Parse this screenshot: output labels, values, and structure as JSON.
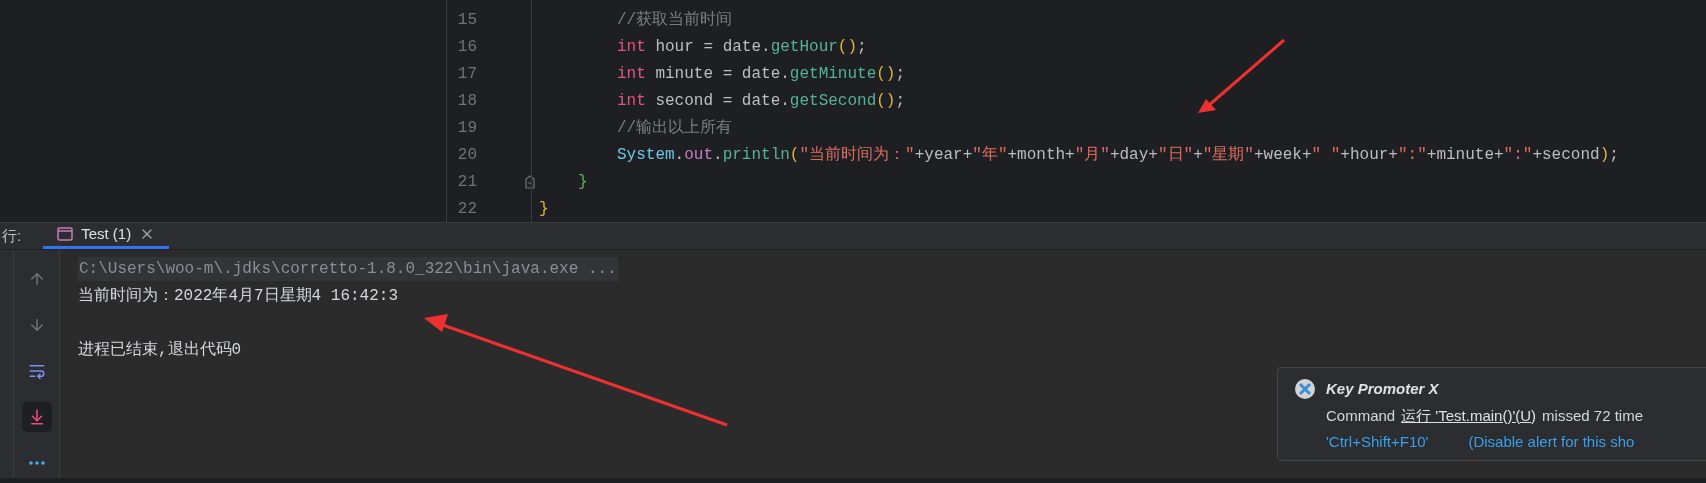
{
  "editor": {
    "lines": [
      {
        "number": "15",
        "kind": "body",
        "tokens": [
          {
            "kind": "comment",
            "text": "//获取当前时间"
          }
        ]
      },
      {
        "number": "16",
        "kind": "body",
        "tokens": [
          {
            "kind": "keyword",
            "text": "int"
          },
          {
            "kind": "plain",
            "text": " hour = date."
          },
          {
            "kind": "method",
            "text": "getHour"
          },
          {
            "kind": "paren",
            "text": "()"
          },
          {
            "kind": "plain",
            "text": ";"
          }
        ]
      },
      {
        "number": "17",
        "kind": "body",
        "tokens": [
          {
            "kind": "keyword",
            "text": "int"
          },
          {
            "kind": "plain",
            "text": " minute = date."
          },
          {
            "kind": "method",
            "text": "getMinute"
          },
          {
            "kind": "paren",
            "text": "()"
          },
          {
            "kind": "plain",
            "text": ";"
          }
        ]
      },
      {
        "number": "18",
        "kind": "body",
        "tokens": [
          {
            "kind": "keyword",
            "text": "int"
          },
          {
            "kind": "plain",
            "text": " second = date."
          },
          {
            "kind": "method",
            "text": "getSecond"
          },
          {
            "kind": "paren",
            "text": "()"
          },
          {
            "kind": "plain",
            "text": ";"
          }
        ]
      },
      {
        "number": "19",
        "kind": "body",
        "tokens": [
          {
            "kind": "comment",
            "text": "//输出以上所有"
          }
        ]
      },
      {
        "number": "20",
        "kind": "body",
        "tokens": [
          {
            "kind": "class",
            "text": "System"
          },
          {
            "kind": "plain",
            "text": "."
          },
          {
            "kind": "field",
            "text": "out"
          },
          {
            "kind": "plain",
            "text": "."
          },
          {
            "kind": "method",
            "text": "println"
          },
          {
            "kind": "paren",
            "text": "("
          },
          {
            "kind": "string",
            "text": "\"当前时间为：\""
          },
          {
            "kind": "plain",
            "text": "+year+"
          },
          {
            "kind": "string",
            "text": "\"年\""
          },
          {
            "kind": "plain",
            "text": "+month+"
          },
          {
            "kind": "string",
            "text": "\"月\""
          },
          {
            "kind": "plain",
            "text": "+day+"
          },
          {
            "kind": "string",
            "text": "\"日\""
          },
          {
            "kind": "plain",
            "text": "+"
          },
          {
            "kind": "string",
            "text": "\"星期\""
          },
          {
            "kind": "plain",
            "text": "+week+"
          },
          {
            "kind": "string",
            "text": "\" \""
          },
          {
            "kind": "plain",
            "text": "+hour+"
          },
          {
            "kind": "string",
            "text": "\":\""
          },
          {
            "kind": "plain",
            "text": "+minute+"
          },
          {
            "kind": "string",
            "text": "\":\""
          },
          {
            "kind": "plain",
            "text": "+second"
          },
          {
            "kind": "paren",
            "text": ")"
          },
          {
            "kind": "plain",
            "text": ";"
          }
        ]
      },
      {
        "number": "21",
        "kind": "method-end",
        "fold": true,
        "tokens": [
          {
            "kind": "brace",
            "text": "}"
          }
        ]
      },
      {
        "number": "22",
        "kind": "class-end",
        "tokens": [
          {
            "kind": "paren",
            "text": "}"
          }
        ]
      }
    ]
  },
  "run_panel": {
    "title": "行:",
    "tabs": [
      {
        "label": "Test (1)",
        "selected": true
      }
    ],
    "toolbar": [
      {
        "kind": "up",
        "selected": false
      },
      {
        "kind": "down",
        "selected": false
      },
      {
        "kind": "wrap",
        "selected": false
      },
      {
        "kind": "scroll-end",
        "selected": true
      },
      {
        "kind": "more",
        "selected": false
      }
    ],
    "console": [
      {
        "kind": "command",
        "text": "C:\\Users\\woo-m\\.jdks\\corretto-1.8.0_322\\bin\\java.exe ..."
      },
      {
        "kind": "output",
        "text": "当前时间为：2022年4月7日星期4 16:42:3"
      },
      {
        "kind": "blank"
      },
      {
        "kind": "output",
        "text": "进程已结束,退出代码0"
      }
    ]
  },
  "notification": {
    "title": "Key Promoter X",
    "message_prefix": "Command",
    "command_link": "运行 'Test.main()'(U)",
    "message_suffix": "missed 72 time",
    "shortcut": "'Ctrl+Shift+F10'",
    "disable_link": "(Disable alert for this sho"
  }
}
